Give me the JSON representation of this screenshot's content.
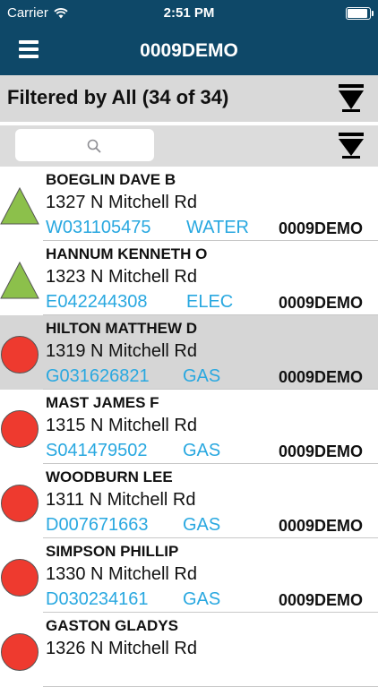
{
  "status_bar": {
    "carrier": "Carrier",
    "time": "2:51 PM"
  },
  "nav": {
    "title": "0009DEMO"
  },
  "filter": {
    "text": "Filtered by All (34 of 34)"
  },
  "colors": {
    "nav_bg": "#0e4868",
    "link": "#29a8e0",
    "triangle": "#8cc04b",
    "circle": "#ee3a2f"
  },
  "rows": [
    {
      "name": "BOEGLIN DAVE B",
      "address": "1327 N Mitchell Rd",
      "meter": "W031105475",
      "utility": "WATER",
      "route": "0009DEMO",
      "status_icon": "green-triangle-icon",
      "selected": false
    },
    {
      "name": "HANNUM KENNETH O",
      "address": "1323 N Mitchell Rd",
      "meter": "E042244308",
      "utility": "ELEC",
      "route": "0009DEMO",
      "status_icon": "green-triangle-icon",
      "selected": false
    },
    {
      "name": "HILTON MATTHEW D",
      "address": "1319 N Mitchell Rd",
      "meter": "G031626821",
      "utility": "GAS",
      "route": "0009DEMO",
      "status_icon": "red-circle-icon",
      "selected": true
    },
    {
      "name": "MAST JAMES F",
      "address": "1315 N Mitchell Rd",
      "meter": "S041479502",
      "utility": "GAS",
      "route": "0009DEMO",
      "status_icon": "red-circle-icon",
      "selected": false
    },
    {
      "name": "WOODBURN LEE",
      "address": "1311 N Mitchell Rd",
      "meter": "D007671663",
      "utility": "GAS",
      "route": "0009DEMO",
      "status_icon": "red-circle-icon",
      "selected": false
    },
    {
      "name": "SIMPSON PHILLIP",
      "address": "1330 N Mitchell Rd",
      "meter": "D030234161",
      "utility": "GAS",
      "route": "0009DEMO",
      "status_icon": "red-circle-icon",
      "selected": false
    },
    {
      "name": "GASTON GLADYS",
      "address": "1326 N Mitchell Rd",
      "meter": "",
      "utility": "",
      "route": "",
      "status_icon": "red-circle-icon",
      "selected": false
    }
  ]
}
